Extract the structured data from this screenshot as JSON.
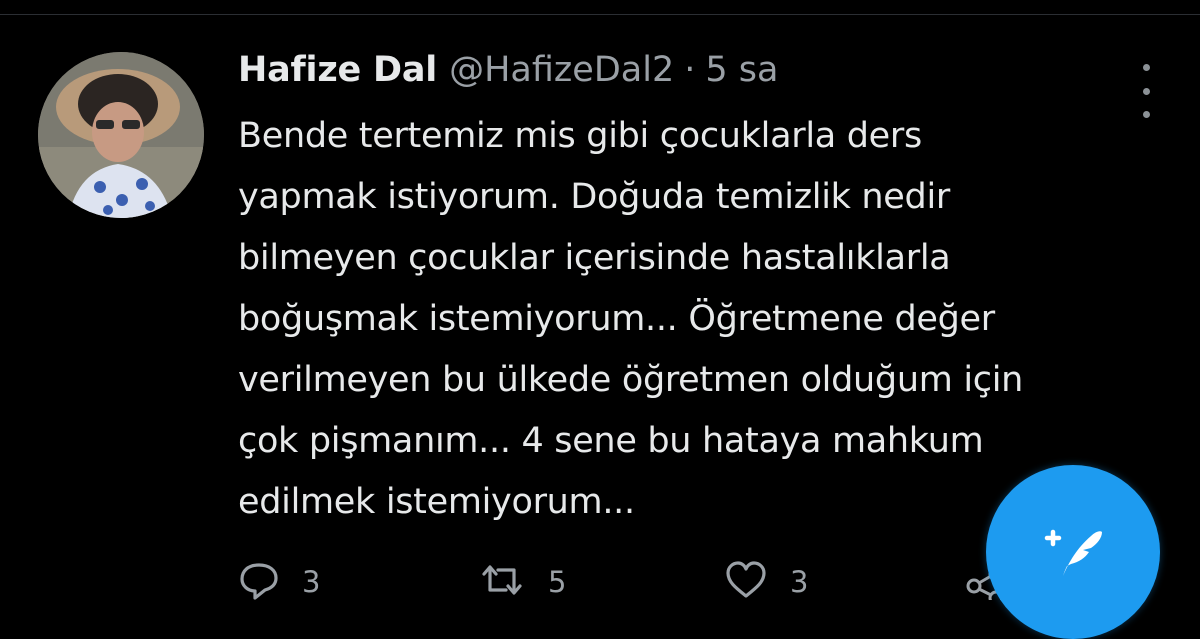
{
  "tweet": {
    "author_name": "Hafize Dal",
    "author_handle": "@HafizeDal2",
    "separator": "·",
    "time": "5 sa",
    "lines": [
      "Bende tertemiz mis gibi çocuklarla ders",
      "yapmak istiyorum. Doğuda temizlik nedir",
      "bilmeyen çocuklar içerisinde hastalıklarla",
      "boğuşmak istemiyorum... Öğretmene değer",
      "verilmeyen bu ülkede öğretmen olduğum için",
      "çok pişmanım... 4 sene bu hataya mahkum",
      "edilmek istemiyorum..."
    ],
    "actions": {
      "reply_count": "3",
      "retweet_count": "5",
      "like_count": "3"
    }
  },
  "icons": {
    "avatar": "avatar",
    "more": "more-vertical-icon",
    "reply": "reply-icon",
    "retweet": "retweet-icon",
    "like": "heart-icon",
    "share": "share-icon",
    "compose": "compose-feather-icon"
  },
  "colors": {
    "background": "#000000",
    "text_primary": "#e7e9ea",
    "text_secondary": "#9aa0a6",
    "accent": "#1d9bf0"
  }
}
